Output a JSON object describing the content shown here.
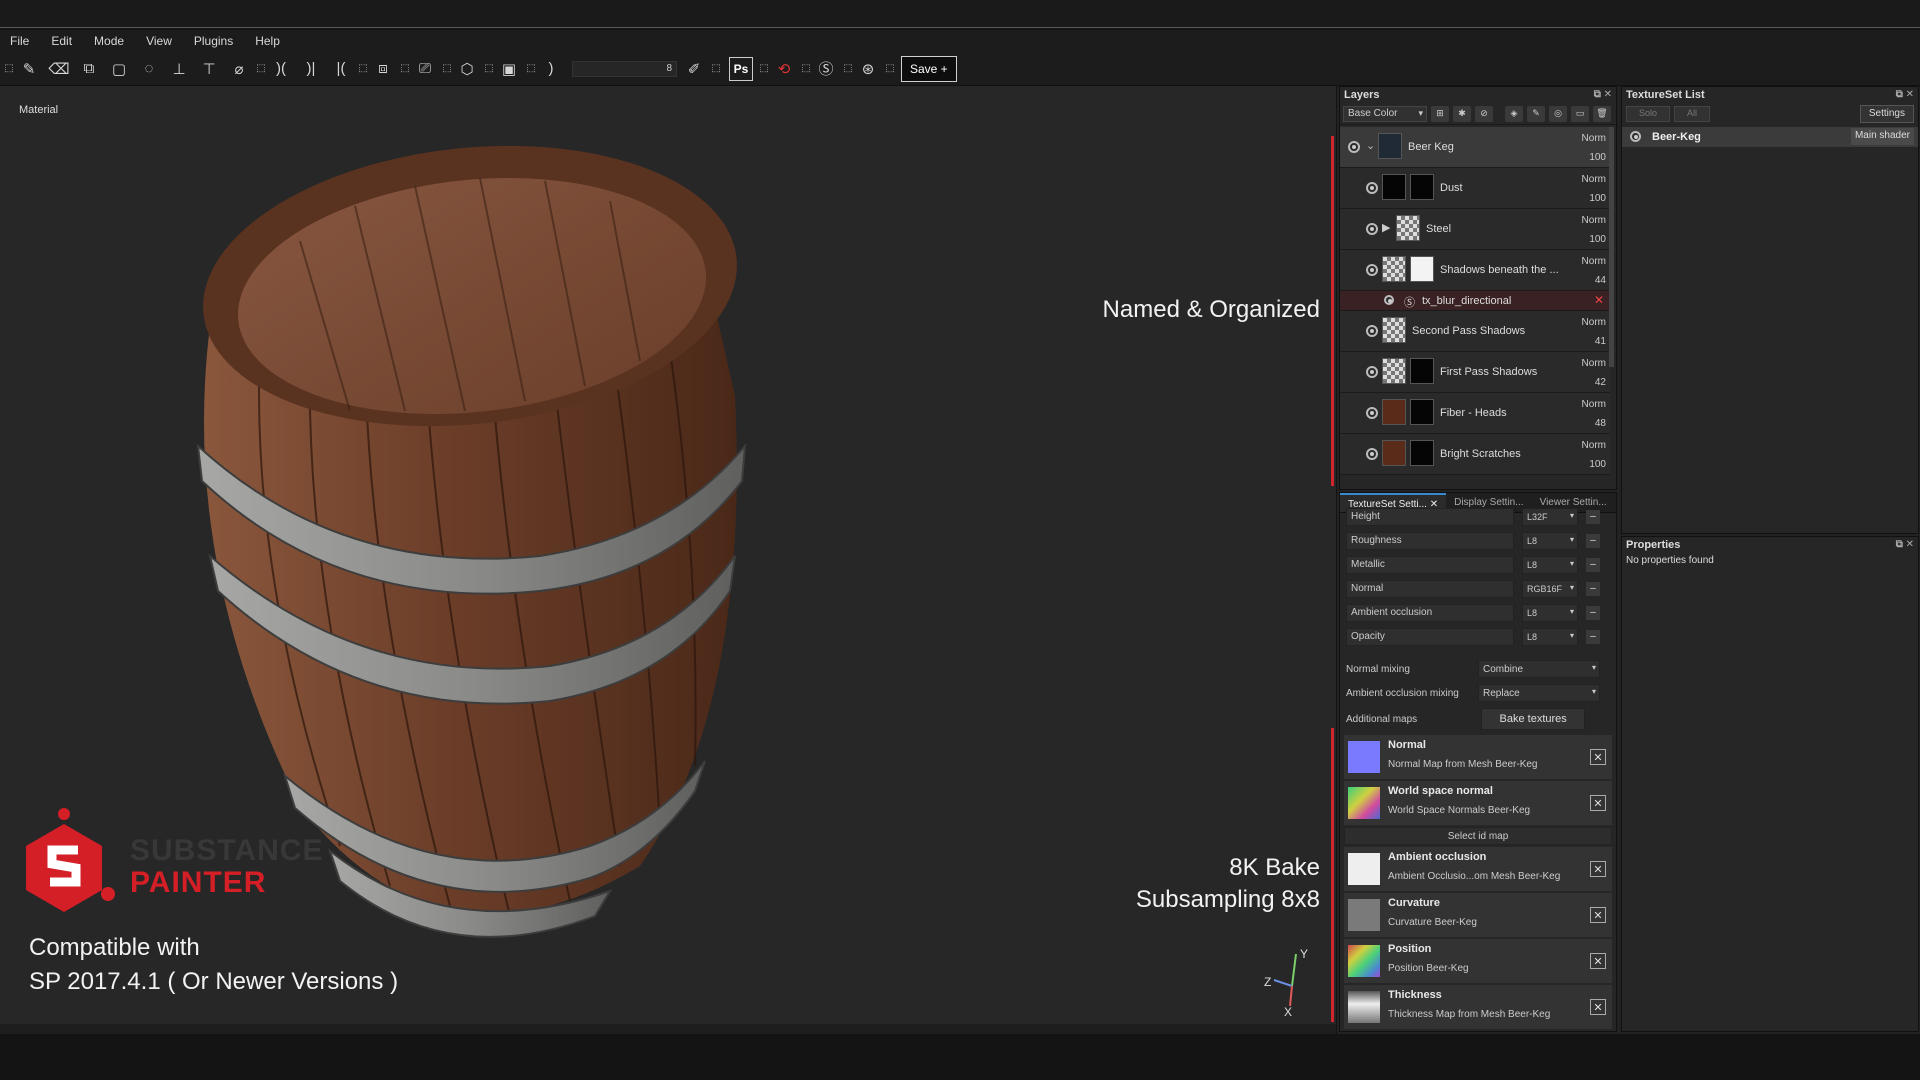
{
  "menu": [
    "File",
    "Edit",
    "Mode",
    "View",
    "Plugins",
    "Help"
  ],
  "toolbar": {
    "size_value": "8",
    "ps_label": "Ps",
    "save_label": "Save +"
  },
  "viewport": {
    "label": "Material",
    "overlay_named": "Named & Organized",
    "overlay_bake1": "8K Bake",
    "overlay_bake2": "Subsampling 8x8",
    "compat1": "Compatible with",
    "compat2": "SP 2017.4.1 ( Or Newer Versions )",
    "logo_line1": "SUBSTANCE",
    "logo_line2": "PAINTER",
    "axis": {
      "y": "Y",
      "z": "Z",
      "x": "X"
    }
  },
  "layers": {
    "title": "Layers",
    "channel": "Base Color",
    "items": [
      {
        "name": "Beer Keg",
        "blend": "Norm",
        "opacity": "100"
      },
      {
        "name": "Dust",
        "blend": "Norm",
        "opacity": "100"
      },
      {
        "name": "Steel",
        "blend": "Norm",
        "opacity": "100"
      },
      {
        "name": "Shadows beneath the ...",
        "blend": "Norm",
        "opacity": "44"
      },
      {
        "name": "Second Pass Shadows",
        "blend": "Norm",
        "opacity": "41"
      },
      {
        "name": "First Pass Shadows",
        "blend": "Norm",
        "opacity": "42"
      },
      {
        "name": "Fiber - Heads",
        "blend": "Norm",
        "opacity": "48"
      },
      {
        "name": "Bright Scratches",
        "blend": "Norm",
        "opacity": "100"
      }
    ],
    "filter": "tx_blur_directional"
  },
  "texture_settings": {
    "tabs": [
      "TextureSet Setti...",
      "Display Settin...",
      "Viewer Settin..."
    ],
    "channels": [
      {
        "name": "Height",
        "format": "L32F"
      },
      {
        "name": "Roughness",
        "format": "L8"
      },
      {
        "name": "Metallic",
        "format": "L8"
      },
      {
        "name": "Normal",
        "format": "RGB16F"
      },
      {
        "name": "Ambient occlusion",
        "format": "L8"
      },
      {
        "name": "Opacity",
        "format": "L8"
      }
    ],
    "normal_mixing_label": "Normal mixing",
    "normal_mixing_value": "Combine",
    "ao_mixing_label": "Ambient occlusion mixing",
    "ao_mixing_value": "Replace",
    "additional_maps_label": "Additional maps",
    "bake_button": "Bake textures",
    "select_id_map": "Select id map",
    "maps": [
      {
        "title": "Normal",
        "sub": "Normal Map from Mesh Beer-Keg"
      },
      {
        "title": "World space normal",
        "sub": "World Space Normals Beer-Keg"
      },
      {
        "title": "Ambient occlusion",
        "sub": "Ambient Occlusio...om Mesh Beer-Keg"
      },
      {
        "title": "Curvature",
        "sub": "Curvature Beer-Keg"
      },
      {
        "title": "Position",
        "sub": "Position Beer-Keg"
      },
      {
        "title": "Thickness",
        "sub": "Thickness Map from Mesh Beer-Keg"
      }
    ]
  },
  "textureset_list": {
    "title": "TextureSet List",
    "solo": "Solo",
    "all": "All",
    "settings": "Settings",
    "item": "Beer-Keg",
    "shader": "Main shader"
  },
  "properties": {
    "title": "Properties",
    "empty": "No properties found"
  },
  "colors": {
    "accent_red": "#d51f27",
    "logo_gray": "#383838",
    "highlight_blue": "#3a8ad0"
  }
}
